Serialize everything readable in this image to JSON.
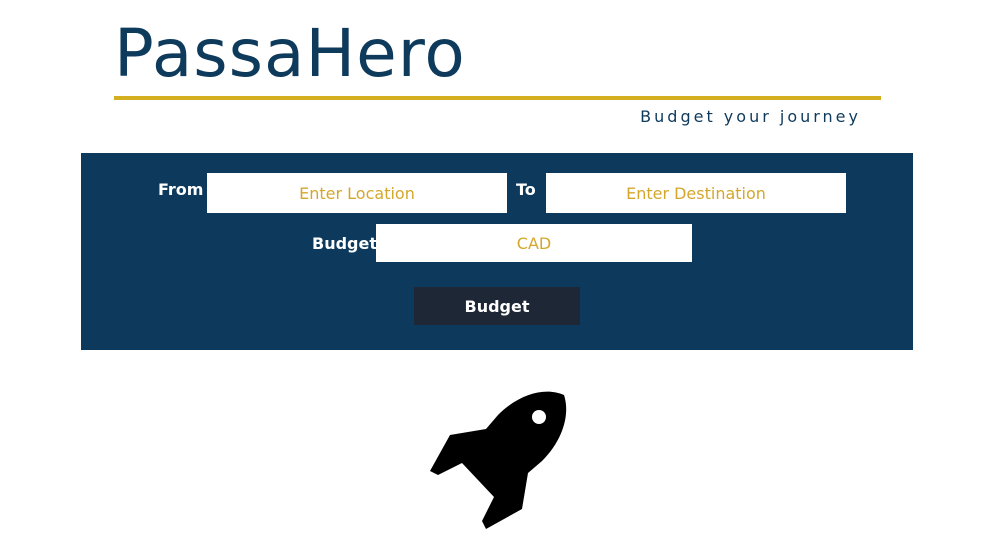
{
  "header": {
    "logo_text": "PassaHero",
    "tagline": "Budget your journey"
  },
  "form": {
    "from_label": "From",
    "from_placeholder": "Enter Location",
    "to_label": "To",
    "to_placeholder": "Enter Destination",
    "budget_label": "Budget",
    "budget_placeholder": "CAD",
    "submit_label": "Budget"
  },
  "hero": {
    "icon": "rocket-icon"
  },
  "colors": {
    "brand_navy": "#0d3a5c",
    "accent_gold": "#d4b020",
    "placeholder_gold": "#d4a72c",
    "button_dark": "#1d2735"
  }
}
